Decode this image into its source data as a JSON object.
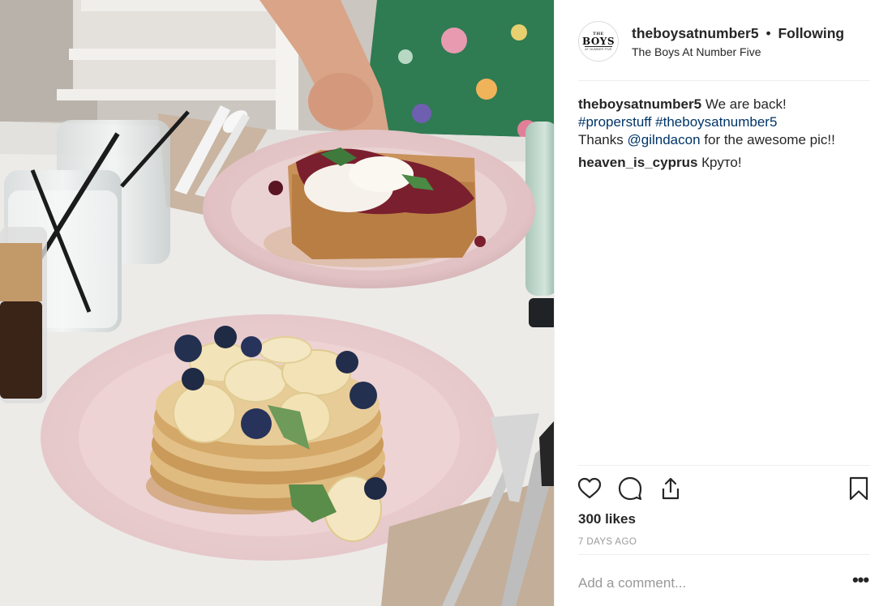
{
  "post": {
    "username": "theboysatnumber5",
    "separator": "•",
    "follow_status": "Following",
    "location": "The Boys At Number Five",
    "avatar_text": {
      "top": "THE",
      "main": "BOYS",
      "bottom": "AT NUMBER FIVE"
    }
  },
  "caption": {
    "username": "theboysatnumber5",
    "text": "We are back!",
    "hashtags": [
      "#properstuff",
      "#theboysatnumber5"
    ],
    "thanks_prefix": "Thanks",
    "mention": "@gilndacon",
    "thanks_suffix": "for the awesome pic!!"
  },
  "comments": [
    {
      "username": "heaven_is_cyprus",
      "text": "Круто!"
    }
  ],
  "actions": {
    "like_icon": "heart-icon",
    "comment_icon": "speech-bubble-icon",
    "share_icon": "share-icon",
    "save_icon": "bookmark-icon"
  },
  "likes_text": "300 likes",
  "timestamp": "7 DAYS AGO",
  "add_comment": {
    "placeholder": "Add a comment...",
    "more_label": "•••"
  },
  "colors": {
    "link": "#003569",
    "text": "#262626",
    "muted": "#999999",
    "divider": "#efefef"
  }
}
